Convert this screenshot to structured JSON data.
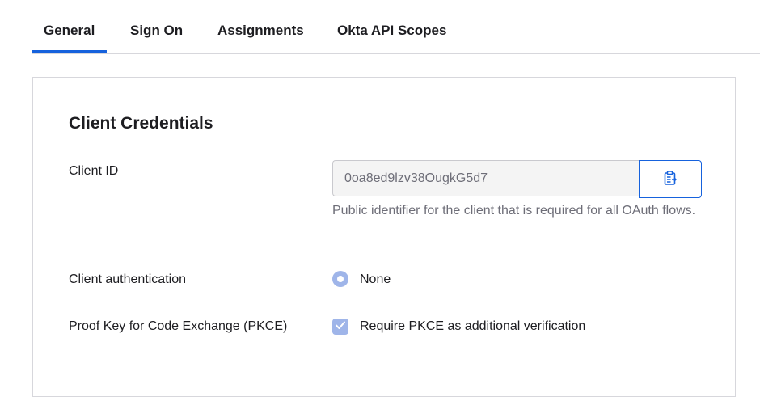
{
  "tabs": [
    {
      "label": "General",
      "active": true
    },
    {
      "label": "Sign On",
      "active": false
    },
    {
      "label": "Assignments",
      "active": false
    },
    {
      "label": "Okta API Scopes",
      "active": false
    }
  ],
  "colors": {
    "accent": "#1662dd",
    "control_disabled": "#9fb5e9",
    "muted_text": "#6e6e78"
  },
  "client_credentials": {
    "title": "Client Credentials",
    "client_id": {
      "label": "Client ID",
      "value": "0oa8ed9lzv38OugkG5d7",
      "copy_icon": "clipboard-icon",
      "help_text": "Public identifier for the client that is required for all OAuth flows."
    },
    "client_authentication": {
      "label": "Client authentication",
      "option": "None",
      "selected": true
    },
    "pkce": {
      "label": "Proof Key for Code Exchange (PKCE)",
      "option": "Require PKCE as additional verification",
      "checked": true
    }
  }
}
